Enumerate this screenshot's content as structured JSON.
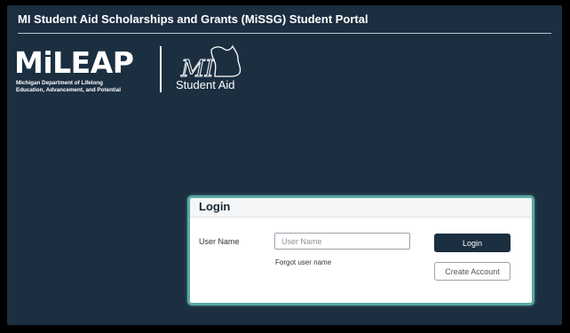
{
  "header": {
    "title": "MI Student Aid Scholarships and Grants (MiSSG) Student Portal"
  },
  "brand": {
    "mileap_wordmark": "MiLEAP",
    "mileap_subtitle_line1": "Michigan Department of Lifelong",
    "mileap_subtitle_line2": "Education, Advancement, and Potential",
    "mi_student_aid_label": "Student Aid",
    "mi_student_aid_mark": "MI"
  },
  "login": {
    "heading": "Login",
    "user_name_label": "User Name",
    "user_name_placeholder": "User Name",
    "user_name_value": "",
    "forgot_user_name": "Forgot user name",
    "login_button": "Login",
    "create_account_button": "Create Account"
  },
  "colors": {
    "background": "#1b2f41",
    "card_border": "#5aa9a0",
    "primary_button": "#1b2f41"
  }
}
